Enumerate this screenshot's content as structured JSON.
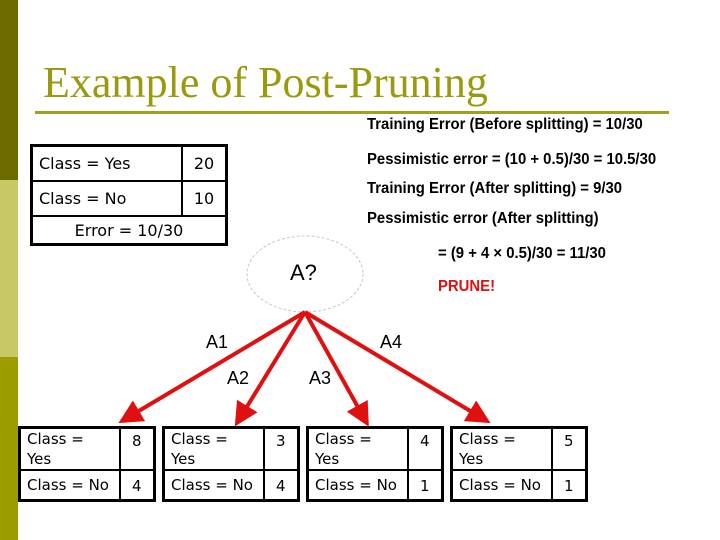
{
  "title": "Example of Post-Pruning",
  "colors": {
    "sidebar_dark": "#6b6b00",
    "sidebar_light": "#c8c864",
    "sidebar_mid": "#9c9c00",
    "title": "#9a9a10",
    "arrow": "#e01010",
    "prune": "#e01010"
  },
  "calculations": {
    "line1": "Training Error (Before splitting) = 10/30",
    "line2": "Pessimistic error = (10 + 0.5)/30 = 10.5/30",
    "line3": "Training Error (After splitting) = 9/30",
    "line4": "Pessimistic error (After splitting)",
    "line5": "= (9 + 4 × 0.5)/30 = 11/30",
    "verdict": "PRUNE!"
  },
  "root_table": {
    "rows": [
      {
        "label": "Class = Yes",
        "count": "20"
      },
      {
        "label": "Class = No",
        "count": "10"
      }
    ],
    "error": "Error = 10/30"
  },
  "root_node": {
    "label": "A?"
  },
  "branches": [
    {
      "label": "A1",
      "table": {
        "rows": [
          {
            "label": "Class = Yes",
            "count": "8"
          },
          {
            "label": "Class = No",
            "count": "4"
          }
        ]
      }
    },
    {
      "label": "A2",
      "table": {
        "rows": [
          {
            "label": "Class = Yes",
            "count": "3"
          },
          {
            "label": "Class = No",
            "count": "4"
          }
        ]
      }
    },
    {
      "label": "A3",
      "table": {
        "rows": [
          {
            "label": "Class = Yes",
            "count": "4"
          },
          {
            "label": "Class = No",
            "count": "1"
          }
        ]
      }
    },
    {
      "label": "A4",
      "table": {
        "rows": [
          {
            "label": "Class = Yes",
            "count": "5"
          },
          {
            "label": "Class = No",
            "count": "1"
          }
        ]
      }
    }
  ]
}
